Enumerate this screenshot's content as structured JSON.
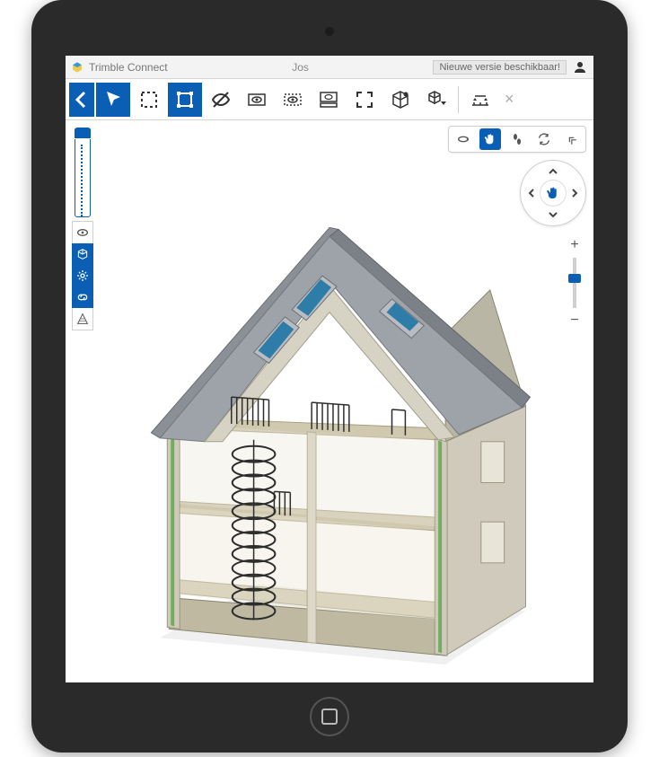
{
  "header": {
    "app_title": "Trimble Connect",
    "document_name": "Jos",
    "notice": "Nieuwe versie beschikbaar!"
  },
  "toolbar": {
    "items": [
      {
        "name": "back-button",
        "icon": "chevron-left",
        "primary": true
      },
      {
        "name": "select-tool",
        "icon": "cursor",
        "primary": true
      },
      {
        "name": "marquee-select",
        "icon": "marquee"
      },
      {
        "name": "node-select",
        "icon": "nodes",
        "primary": true
      },
      {
        "name": "visibility-toggle",
        "icon": "eye-slash"
      },
      {
        "name": "show-layer",
        "icon": "eye-boxed"
      },
      {
        "name": "group-visibility",
        "icon": "eye-dashed"
      },
      {
        "name": "layer-visibility",
        "icon": "eye-stacked"
      },
      {
        "name": "fit-view",
        "icon": "expand-arrows"
      },
      {
        "name": "cube-view",
        "icon": "cube-dot"
      },
      {
        "name": "cube-dropdown",
        "icon": "cube-caret"
      },
      {
        "name": "measure-tool",
        "icon": "ruler"
      },
      {
        "name": "close-button",
        "icon": "x"
      }
    ]
  },
  "side_panel": {
    "items": [
      {
        "name": "visibility-icon",
        "icon": "eye"
      },
      {
        "name": "model-cube",
        "icon": "cube",
        "active": true
      },
      {
        "name": "settings-gear",
        "icon": "gear",
        "active": true
      },
      {
        "name": "link-icon",
        "icon": "link",
        "active": true
      },
      {
        "name": "layers-icon",
        "icon": "hatch"
      }
    ]
  },
  "nav": {
    "row": [
      {
        "name": "orbit-mode",
        "icon": "orbit"
      },
      {
        "name": "pan-mode",
        "icon": "hand",
        "active": true
      },
      {
        "name": "walk-mode",
        "icon": "steps"
      },
      {
        "name": "sync-mode",
        "icon": "sync"
      },
      {
        "name": "collapse-nav",
        "icon": "collapse"
      }
    ]
  },
  "colors": {
    "primary": "#0a5fb4",
    "roof": "#7c8188",
    "wall": "#d8d4c8",
    "floor": "#c7bfa8",
    "skylight": "#2e7ca8"
  }
}
